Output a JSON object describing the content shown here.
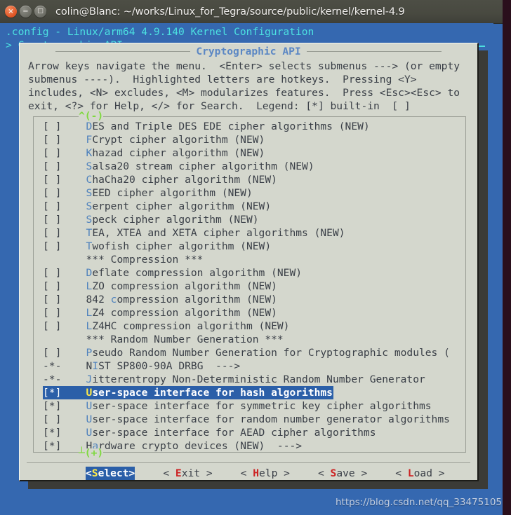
{
  "window": {
    "title": "colin@Blanc: ~/works/Linux_for_Tegra/source/public/kernel/kernel-4.9",
    "controls": [
      {
        "name": "close",
        "glyph": "×"
      },
      {
        "name": "minimize",
        "glyph": "−"
      },
      {
        "name": "maximize",
        "glyph": "□"
      }
    ]
  },
  "terminal": {
    "config_line": ".config - Linux/arm64 4.9.140 Kernel Configuration",
    "breadcrumb": "> Cryptographic API"
  },
  "dialog": {
    "title": "Cryptographic API",
    "help_text": "Arrow keys navigate the menu.  <Enter> selects submenus ---> (or empty\nsubmenus ----).  Highlighted letters are hotkeys.  Pressing <Y>\nincludes, <N> excludes, <M> modularizes features.  Press <Esc><Esc> to\nexit, <?> for Help, </> for Search.  Legend: [*] built-in  [ ]",
    "scroll_up": "^(-)",
    "scroll_down": "┴(+)",
    "items": [
      {
        "state": "[ ]",
        "pre": "",
        "hotkey": "D",
        "post": "ES and Triple DES EDE cipher algorithms (NEW)"
      },
      {
        "state": "[ ]",
        "pre": "",
        "hotkey": "F",
        "post": "Crypt cipher algorithm (NEW)"
      },
      {
        "state": "[ ]",
        "pre": "",
        "hotkey": "K",
        "post": "hazad cipher algorithm (NEW)"
      },
      {
        "state": "[ ]",
        "pre": "",
        "hotkey": "S",
        "post": "alsa20 stream cipher algorithm (NEW)"
      },
      {
        "state": "[ ]",
        "pre": "",
        "hotkey": "C",
        "post": "haCha20 cipher algorithm (NEW)"
      },
      {
        "state": "[ ]",
        "pre": "",
        "hotkey": "S",
        "post": "EED cipher algorithm (NEW)"
      },
      {
        "state": "[ ]",
        "pre": "",
        "hotkey": "S",
        "post": "erpent cipher algorithm (NEW)"
      },
      {
        "state": "[ ]",
        "pre": "",
        "hotkey": "S",
        "post": "peck cipher algorithm (NEW)"
      },
      {
        "state": "[ ]",
        "pre": "",
        "hotkey": "T",
        "post": "EA, XTEA and XETA cipher algorithms (NEW)"
      },
      {
        "state": "[ ]",
        "pre": "",
        "hotkey": "T",
        "post": "wofish cipher algorithm (NEW)"
      },
      {
        "state": "   ",
        "pre": "*** Compression ***",
        "hotkey": "",
        "post": "",
        "separator": true
      },
      {
        "state": "[ ]",
        "pre": "",
        "hotkey": "D",
        "post": "eflate compression algorithm (NEW)"
      },
      {
        "state": "[ ]",
        "pre": "",
        "hotkey": "L",
        "post": "ZO compression algorithm (NEW)"
      },
      {
        "state": "[ ]",
        "pre": "842 ",
        "hotkey": "c",
        "post": "ompression algorithm (NEW)"
      },
      {
        "state": "[ ]",
        "pre": "",
        "hotkey": "L",
        "post": "Z4 compression algorithm (NEW)"
      },
      {
        "state": "[ ]",
        "pre": "",
        "hotkey": "L",
        "post": "Z4HC compression algorithm (NEW)"
      },
      {
        "state": "   ",
        "pre": "*** Random Number Generation ***",
        "hotkey": "",
        "post": "",
        "separator": true
      },
      {
        "state": "[ ]",
        "pre": "",
        "hotkey": "P",
        "post": "seudo Random Number Generation for Cryptographic modules ("
      },
      {
        "state": "-*-",
        "pre": "N",
        "hotkey": "I",
        "post": "ST SP800-90A DRBG  --->"
      },
      {
        "state": "-*-",
        "pre": "",
        "hotkey": "J",
        "post": "itterentropy Non-Deterministic Random Number Generator"
      },
      {
        "state": "[*]",
        "pre": "",
        "hotkey": "U",
        "post": "ser-space interface for hash algorithms",
        "selected": true
      },
      {
        "state": "[*]",
        "pre": "",
        "hotkey": "U",
        "post": "ser-space interface for symmetric key cipher algorithms"
      },
      {
        "state": "[ ]",
        "pre": "",
        "hotkey": "U",
        "post": "ser-space interface for random number generator algorithms"
      },
      {
        "state": "[*]",
        "pre": "",
        "hotkey": "U",
        "post": "ser-space interface for AEAD cipher algorithms"
      },
      {
        "state": "[*]",
        "pre": "H",
        "hotkey": "a",
        "post": "rdware crypto devices (NEW)  --->"
      }
    ],
    "buttons": [
      {
        "open": "<",
        "pre": "",
        "hotkey": "S",
        "post": "elect",
        "close": ">",
        "active": true
      },
      {
        "open": "< ",
        "pre": "",
        "hotkey": "E",
        "post": "xit",
        "close": " >",
        "active": false
      },
      {
        "open": "< ",
        "pre": "",
        "hotkey": "H",
        "post": "elp",
        "close": " >",
        "active": false
      },
      {
        "open": "< ",
        "pre": "",
        "hotkey": "S",
        "post": "ave",
        "close": " >",
        "active": false
      },
      {
        "open": "< ",
        "pre": "",
        "hotkey": "L",
        "post": "oad",
        "close": " >",
        "active": false
      }
    ]
  },
  "watermark": "https://blog.csdn.net/qq_33475105",
  "colors": {
    "terminal_bg": "#3568b0",
    "terminal_fg": "#4ce0e0",
    "dialog_bg": "#d4d7cd",
    "dialog_fg": "#3a3f47",
    "hotkey": "#4f82bd",
    "selection_bg": "#2b5fa8",
    "selection_hotkey": "#ffe94a",
    "button_hotkey": "#cc2222",
    "scroll_indicator": "#7fd93f",
    "dialog_title": "#5b87c4"
  }
}
